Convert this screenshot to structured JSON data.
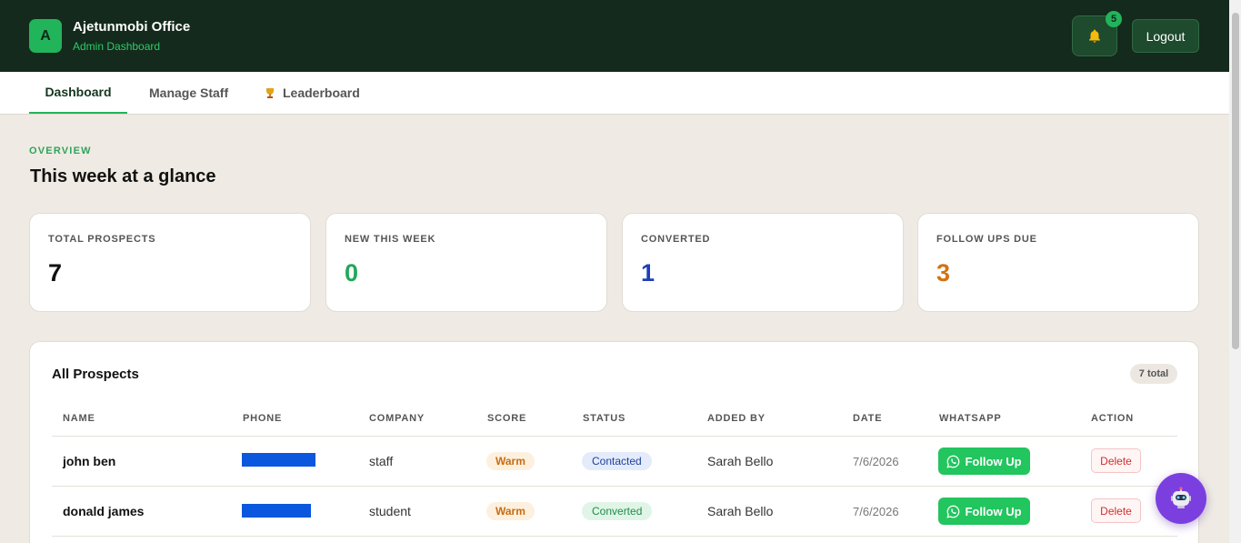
{
  "header": {
    "avatar_letter": "A",
    "title": "Ajetunmobi Office",
    "subtitle": "Admin Dashboard",
    "notification_count": "5",
    "logout_label": "Logout"
  },
  "tabs": [
    {
      "label": "Dashboard",
      "active": true
    },
    {
      "label": "Manage Staff",
      "active": false
    },
    {
      "label": "Leaderboard",
      "icon": "trophy-icon",
      "active": false
    }
  ],
  "overview": {
    "eyebrow": "OVERVIEW",
    "title": "This week at a glance"
  },
  "stats": [
    {
      "label": "TOTAL PROSPECTS",
      "value": "7",
      "color": "#111111"
    },
    {
      "label": "NEW THIS WEEK",
      "value": "0",
      "color": "#22a85a"
    },
    {
      "label": "CONVERTED",
      "value": "1",
      "color": "#1f3fb8"
    },
    {
      "label": "FOLLOW UPS DUE",
      "value": "3",
      "color": "#d4720f"
    }
  ],
  "prospects": {
    "title": "All Prospects",
    "total_label": "7 total",
    "columns": [
      "NAME",
      "PHONE",
      "COMPANY",
      "SCORE",
      "STATUS",
      "ADDED BY",
      "DATE",
      "WHATSAPP",
      "ACTION"
    ],
    "rows": [
      {
        "name": "john ben",
        "company": "staff",
        "score": "Warm",
        "status": "Contacted",
        "added_by": "Sarah Bello",
        "date": "7/6/2026",
        "whatsapp_label": "Follow Up",
        "action_label": "Delete"
      },
      {
        "name": "donald james",
        "company": "student",
        "score": "Warm",
        "status": "Converted",
        "added_by": "Sarah Bello",
        "date": "7/6/2026",
        "whatsapp_label": "Follow Up",
        "action_label": "Delete"
      }
    ]
  },
  "icons": {
    "notification": "bell-icon",
    "whatsapp": "whatsapp-icon",
    "assistant": "robot-icon",
    "leaderboard": "trophy-icon"
  },
  "colors": {
    "header_bg": "#132a1c",
    "accent": "#22b45b",
    "page_bg": "#efebe4",
    "whatsapp": "#22c55e",
    "assistant": "#7b3fe0"
  }
}
